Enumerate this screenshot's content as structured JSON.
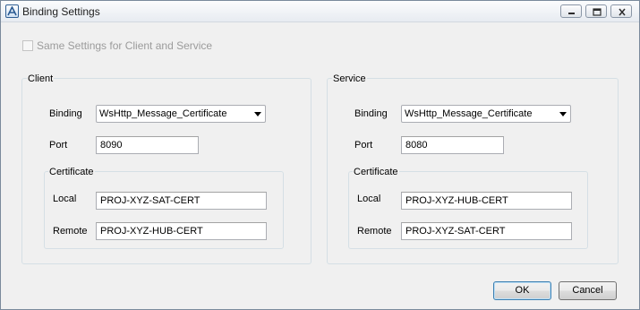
{
  "window": {
    "title": "Binding Settings",
    "icons": {
      "app": "app-a-icon",
      "minimize": "minimize-icon",
      "restore": "restore-icon",
      "close": "close-icon"
    }
  },
  "same_settings": {
    "label": "Same Settings for Client and Service",
    "checked": false,
    "enabled": false
  },
  "client": {
    "title": "Client",
    "binding_label": "Binding",
    "binding_value": "WsHttp_Message_Certificate",
    "port_label": "Port",
    "port_value": "8090",
    "certificate": {
      "title": "Certificate",
      "local_label": "Local",
      "local_value": "PROJ-XYZ-SAT-CERT",
      "remote_label": "Remote",
      "remote_value": "PROJ-XYZ-HUB-CERT"
    }
  },
  "service": {
    "title": "Service",
    "binding_label": "Binding",
    "binding_value": "WsHttp_Message_Certificate",
    "port_label": "Port",
    "port_value": "8080",
    "certificate": {
      "title": "Certificate",
      "local_label": "Local",
      "local_value": "PROJ-XYZ-HUB-CERT",
      "remote_label": "Remote",
      "remote_value": "PROJ-XYZ-SAT-CERT"
    }
  },
  "buttons": {
    "ok": "OK",
    "cancel": "Cancel"
  }
}
